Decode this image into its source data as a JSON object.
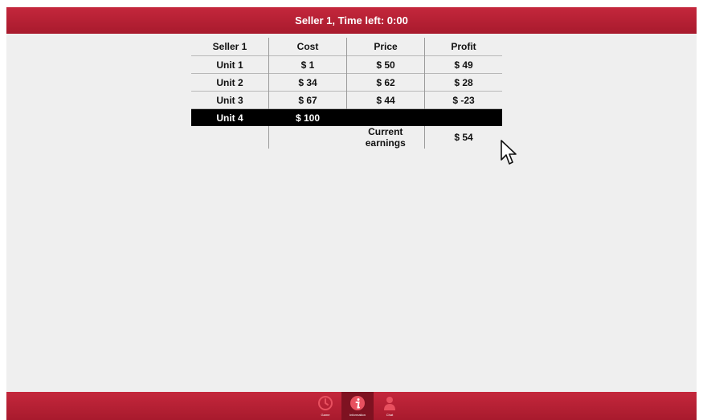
{
  "header": {
    "title": "Seller 1, Time left: 0:00"
  },
  "table": {
    "columns": [
      "Seller 1",
      "Cost",
      "Price",
      "Profit"
    ],
    "rows": [
      [
        "Unit 1",
        "$ 1",
        "$ 50",
        "$ 49"
      ],
      [
        "Unit 2",
        "$ 34",
        "$ 62",
        "$ 28"
      ],
      [
        "Unit 3",
        "$ 67",
        "$ 44",
        "$ -23"
      ],
      [
        "Unit 4",
        "$ 100",
        "",
        ""
      ]
    ],
    "selected_row_index": 3
  },
  "earnings": {
    "label": "Current earnings",
    "value": "$ 54"
  },
  "footer_nav": [
    {
      "label": "Game",
      "icon": "clock-icon"
    },
    {
      "label": "Information",
      "icon": "info-icon"
    },
    {
      "label": "Chat",
      "icon": "user-icon"
    }
  ],
  "colors": {
    "bar": "#b51f33",
    "active_tab": "#7e1221",
    "background": "#efefef",
    "selected_row": "#000000"
  }
}
